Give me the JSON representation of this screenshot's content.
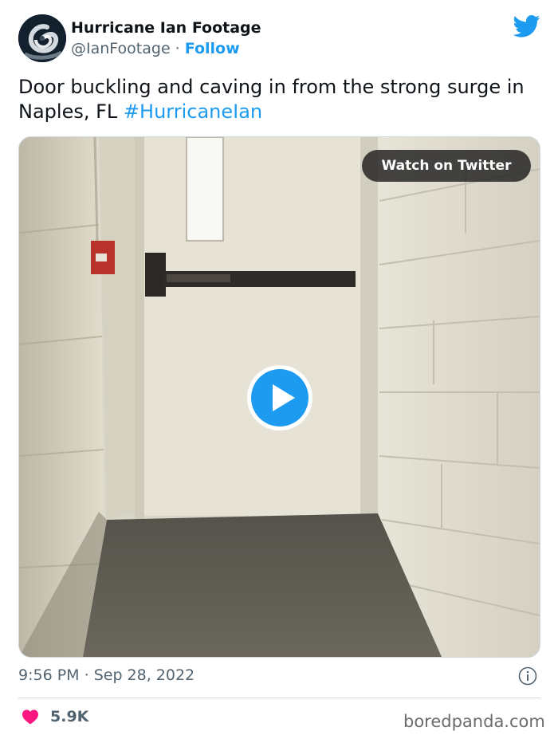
{
  "author": {
    "name": "Hurricane Ian Footage",
    "handle": "@IanFootage",
    "separator": " · ",
    "follow_label": "Follow",
    "avatar_icon": "hurricane-satellite-avatar"
  },
  "brand": {
    "icon": "twitter-bird-icon",
    "color": "#1d9bf0"
  },
  "tweet": {
    "text": "Door buckling and caving in from the strong surge in Naples, FL ",
    "hashtag": "#HurricaneIan"
  },
  "media": {
    "watch_label": "Watch on Twitter",
    "play_icon": "play-icon",
    "scene": "hallway-door-video-thumbnail"
  },
  "footer": {
    "time": "9:56 PM",
    "date_separator": " · ",
    "date": "Sep 28, 2022",
    "info_icon": "info-icon",
    "like_icon": "heart-icon",
    "like_color": "#f91880",
    "likes": "5.9K"
  },
  "watermark": "boredpanda.com"
}
